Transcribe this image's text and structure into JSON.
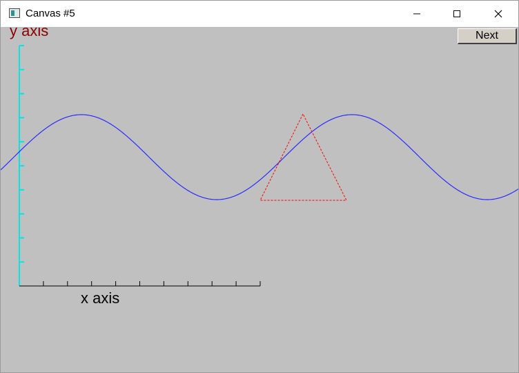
{
  "window": {
    "title": "Canvas #5"
  },
  "controls": {
    "next_label": "Next"
  },
  "canvas": {
    "background": "#c0c0c0",
    "y_axis_label": "y axis",
    "x_axis_label": "x axis",
    "y_axis_color": "#00e5e5",
    "y_axis_label_color": "#8b0000",
    "x_axis_color": "#000000",
    "sine_color": "#2a2aff",
    "triangle_color": "#ff0000"
  },
  "icons": {
    "app": "canvas-window-icon",
    "minimize": "minimize-icon",
    "maximize": "maximize-icon",
    "close": "close-icon"
  }
}
